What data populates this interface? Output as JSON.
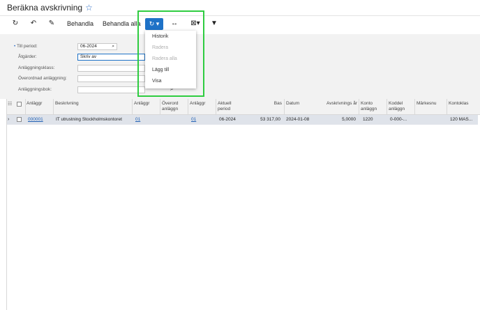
{
  "page": {
    "title": "Beräkna avskrivning"
  },
  "toolbar": {
    "process_label": "Behandla",
    "process_all_label": "Behandla alla",
    "icons": [
      "refresh-icon",
      "undo-icon",
      "edit-icon",
      "refresh-dropdown-icon",
      "fit-columns-icon",
      "export-icon",
      "filter-icon"
    ]
  },
  "dropdown": {
    "items": [
      {
        "label": "Historik",
        "enabled": true
      },
      {
        "label": "Radera",
        "enabled": false
      },
      {
        "label": "Radera alla",
        "enabled": false
      },
      {
        "label": "Lägg till",
        "enabled": true
      },
      {
        "label": "Visa",
        "enabled": true
      }
    ]
  },
  "form": {
    "to_period_label": "Till period:",
    "to_period_value": "06-2024",
    "action_label": "Åtgärder:",
    "action_value": "Skriv av",
    "asset_class_label": "Anläggningsklass:",
    "parent_asset_label": "Överordnad anläggning:",
    "asset_book_label": "Anläggningsbok:"
  },
  "grid": {
    "columns": [
      "Anläggr",
      "Beskrivning",
      "Anläggr",
      "Överord anläggn",
      "Anläggr",
      "Aktuell period",
      "Bas",
      "Datum",
      "Avskrivnings år",
      "Konto anläggn",
      "Koddel anläggn",
      "Märkesnu",
      "Kontoklas"
    ],
    "rows": [
      {
        "asset": "000001",
        "description": "IT utrustning Stockholmskontoret",
        "class": "01",
        "parent": "",
        "book": "01",
        "period": "06-2024",
        "base": "53 317,00",
        "date": "2024-01-08",
        "years": "5,0000",
        "account": "1220",
        "subaccount": "0-000-...",
        "tag": "",
        "acct_class": "120 MAS..."
      }
    ]
  },
  "colors": {
    "accent": "#1e72c7",
    "highlight": "#2ecc40",
    "selected_row": "#dfe3ea"
  }
}
